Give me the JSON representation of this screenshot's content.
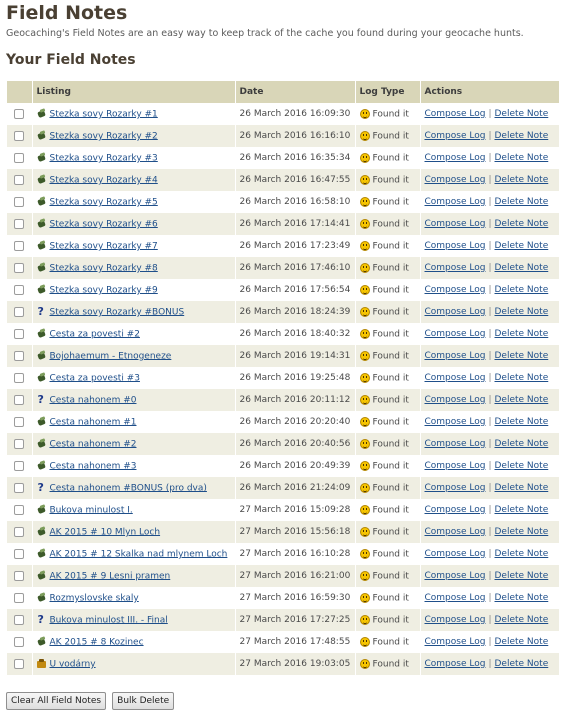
{
  "header": {
    "title": "Field Notes",
    "description": "Geocaching's Field Notes are an easy way to keep track of the cache you found during your geocache hunts.",
    "section_title": "Your Field Notes"
  },
  "table": {
    "columns": [
      "",
      "Listing",
      "Date",
      "Log Type",
      "Actions"
    ],
    "action_labels": {
      "compose": "Compose Log",
      "separator": "|",
      "delete": "Delete Note"
    },
    "rows": [
      {
        "icon": "traditional-cache-icon",
        "listing": "Stezka sovy Rozarky #1",
        "date": "26 March 2016 16:09:30",
        "log_type": "Found it"
      },
      {
        "icon": "traditional-cache-icon",
        "listing": "Stezka sovy Rozarky #2",
        "date": "26 March 2016 16:16:10",
        "log_type": "Found it"
      },
      {
        "icon": "traditional-cache-icon",
        "listing": "Stezka sovy Rozarky #3",
        "date": "26 March 2016 16:35:34",
        "log_type": "Found it"
      },
      {
        "icon": "traditional-cache-icon",
        "listing": "Stezka sovy Rozarky #4",
        "date": "26 March 2016 16:47:55",
        "log_type": "Found it"
      },
      {
        "icon": "traditional-cache-icon",
        "listing": "Stezka sovy Rozarky #5",
        "date": "26 March 2016 16:58:10",
        "log_type": "Found it"
      },
      {
        "icon": "traditional-cache-icon",
        "listing": "Stezka sovy Rozarky #6",
        "date": "26 March 2016 17:14:41",
        "log_type": "Found it"
      },
      {
        "icon": "traditional-cache-icon",
        "listing": "Stezka sovy Rozarky #7",
        "date": "26 March 2016 17:23:49",
        "log_type": "Found it"
      },
      {
        "icon": "traditional-cache-icon",
        "listing": "Stezka sovy Rozarky #8",
        "date": "26 March 2016 17:46:10",
        "log_type": "Found it"
      },
      {
        "icon": "traditional-cache-icon",
        "listing": "Stezka sovy Rozarky #9",
        "date": "26 March 2016 17:56:54",
        "log_type": "Found it"
      },
      {
        "icon": "mystery-cache-icon",
        "listing": "Stezka sovy Rozarky #BONUS",
        "date": "26 March 2016 18:24:39",
        "log_type": "Found it"
      },
      {
        "icon": "traditional-cache-icon",
        "listing": "Cesta za povesti #2",
        "date": "26 March 2016 18:40:32",
        "log_type": "Found it"
      },
      {
        "icon": "traditional-cache-icon",
        "listing": "Bojohaemum - Etnogeneze",
        "date": "26 March 2016 19:14:31",
        "log_type": "Found it"
      },
      {
        "icon": "traditional-cache-icon",
        "listing": "Cesta za povesti #3",
        "date": "26 March 2016 19:25:48",
        "log_type": "Found it"
      },
      {
        "icon": "mystery-cache-icon",
        "listing": "Cesta nahonem #0",
        "date": "26 March 2016 20:11:12",
        "log_type": "Found it"
      },
      {
        "icon": "traditional-cache-icon",
        "listing": "Cesta nahonem #1",
        "date": "26 March 2016 20:20:40",
        "log_type": "Found it"
      },
      {
        "icon": "traditional-cache-icon",
        "listing": "Cesta nahonem #2",
        "date": "26 March 2016 20:40:56",
        "log_type": "Found it"
      },
      {
        "icon": "traditional-cache-icon",
        "listing": "Cesta nahonem #3",
        "date": "26 March 2016 20:49:39",
        "log_type": "Found it"
      },
      {
        "icon": "mystery-cache-icon",
        "listing": "Cesta nahonem #BONUS (pro dva)",
        "date": "26 March 2016 21:24:09",
        "log_type": "Found it"
      },
      {
        "icon": "traditional-cache-icon",
        "listing": "Bukova minulost I.",
        "date": "27 March 2016 15:09:28",
        "log_type": "Found it"
      },
      {
        "icon": "traditional-cache-icon",
        "listing": "AK 2015 # 10 Mlyn Loch",
        "date": "27 March 2016 15:56:18",
        "log_type": "Found it"
      },
      {
        "icon": "traditional-cache-icon",
        "listing": "AK 2015 # 12 Skalka nad mlynem Loch",
        "date": "27 March 2016 16:10:28",
        "log_type": "Found it"
      },
      {
        "icon": "traditional-cache-icon",
        "listing": "AK 2015 # 9 Lesni pramen",
        "date": "27 March 2016 16:21:00",
        "log_type": "Found it"
      },
      {
        "icon": "traditional-cache-icon",
        "listing": "Rozmyslovske skaly",
        "date": "27 March 2016 16:59:30",
        "log_type": "Found it"
      },
      {
        "icon": "mystery-cache-icon",
        "listing": "Bukova minulost III. - Final",
        "date": "27 March 2016 17:27:25",
        "log_type": "Found it"
      },
      {
        "icon": "traditional-cache-icon",
        "listing": "AK 2015 # 8 Kozinec",
        "date": "27 March 2016 17:48:55",
        "log_type": "Found it"
      },
      {
        "icon": "multi-cache-icon",
        "listing": "U vodárny",
        "date": "27 March 2016 19:03:05",
        "log_type": "Found it"
      }
    ]
  },
  "footer": {
    "clear_all_label": "Clear All Field Notes",
    "bulk_delete_label": "Bulk Delete"
  },
  "colors": {
    "header_bg": "#d9d6b8",
    "row_alt_bg": "#efeee2",
    "link": "#1f4f8a",
    "title": "#4a4033"
  }
}
